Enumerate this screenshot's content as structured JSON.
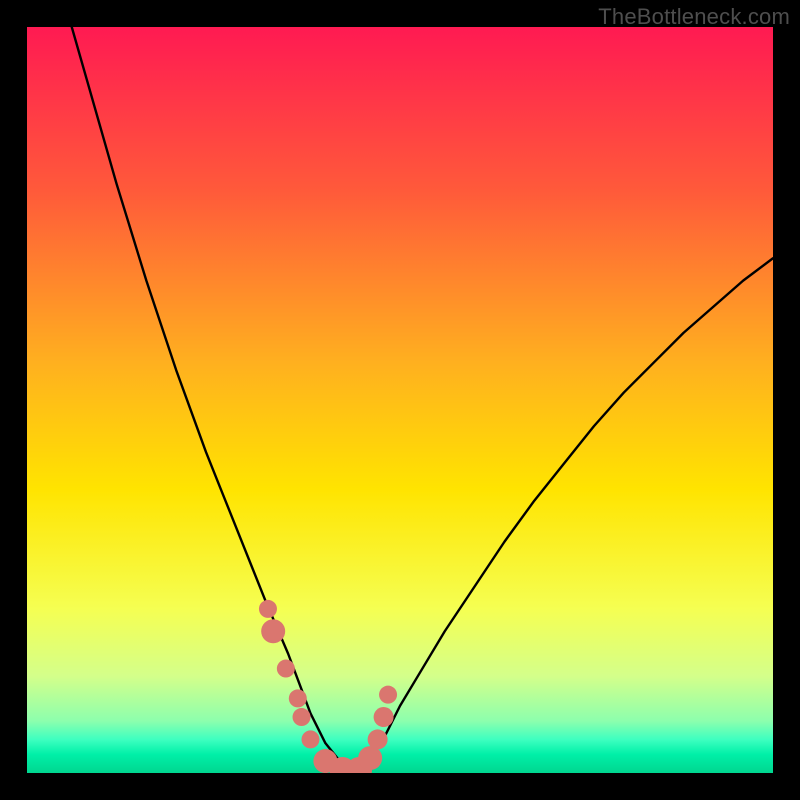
{
  "watermark": {
    "text": "TheBottleneck.com"
  },
  "chart_data": {
    "type": "line",
    "title": "",
    "xlabel": "",
    "ylabel": "",
    "xlim": [
      0,
      100
    ],
    "ylim": [
      0,
      100
    ],
    "grid": false,
    "legend": false,
    "gradient_stops": [
      {
        "offset": 0,
        "color": "#ff1a52"
      },
      {
        "offset": 0.22,
        "color": "#ff5a3a"
      },
      {
        "offset": 0.45,
        "color": "#ffb01f"
      },
      {
        "offset": 0.62,
        "color": "#ffe400"
      },
      {
        "offset": 0.78,
        "color": "#f5ff52"
      },
      {
        "offset": 0.87,
        "color": "#d4ff8a"
      },
      {
        "offset": 0.93,
        "color": "#8dffad"
      },
      {
        "offset": 0.955,
        "color": "#3effc0"
      },
      {
        "offset": 0.975,
        "color": "#00f0a8"
      },
      {
        "offset": 1.0,
        "color": "#00d68f"
      }
    ],
    "series": [
      {
        "name": "bottleneck-curve",
        "stroke": "#000000",
        "stroke_width": 2.4,
        "x": [
          6,
          8,
          10,
          12,
          14,
          16,
          18,
          20,
          22,
          24,
          26,
          28,
          30,
          32,
          33.5,
          35,
          36.5,
          38,
          40,
          42,
          44,
          46,
          48,
          50,
          53,
          56,
          60,
          64,
          68,
          72,
          76,
          80,
          84,
          88,
          92,
          96,
          100
        ],
        "y": [
          100,
          93,
          86,
          79,
          72.5,
          66,
          60,
          54,
          48.5,
          43,
          38,
          33,
          28,
          23,
          19.5,
          16,
          12,
          8,
          4,
          1.5,
          0.4,
          1.8,
          5,
          9,
          14,
          19,
          25,
          31,
          36.5,
          41.5,
          46.5,
          51,
          55,
          59,
          62.5,
          66,
          69
        ]
      }
    ],
    "scatter": {
      "name": "highlight-points",
      "fill": "#da766f",
      "x": [
        32.3,
        33.0,
        34.7,
        36.3,
        36.8,
        38.0,
        40.0,
        42.3,
        44.5,
        46.0,
        47.0,
        47.8,
        48.4
      ],
      "y": [
        22.0,
        19.0,
        14.0,
        10.0,
        7.5,
        4.5,
        1.6,
        0.4,
        0.4,
        2.0,
        4.5,
        7.5,
        10.5
      ],
      "r": [
        9,
        12,
        9,
        9,
        9,
        9,
        12,
        13,
        13,
        12,
        10,
        10,
        9
      ]
    }
  }
}
